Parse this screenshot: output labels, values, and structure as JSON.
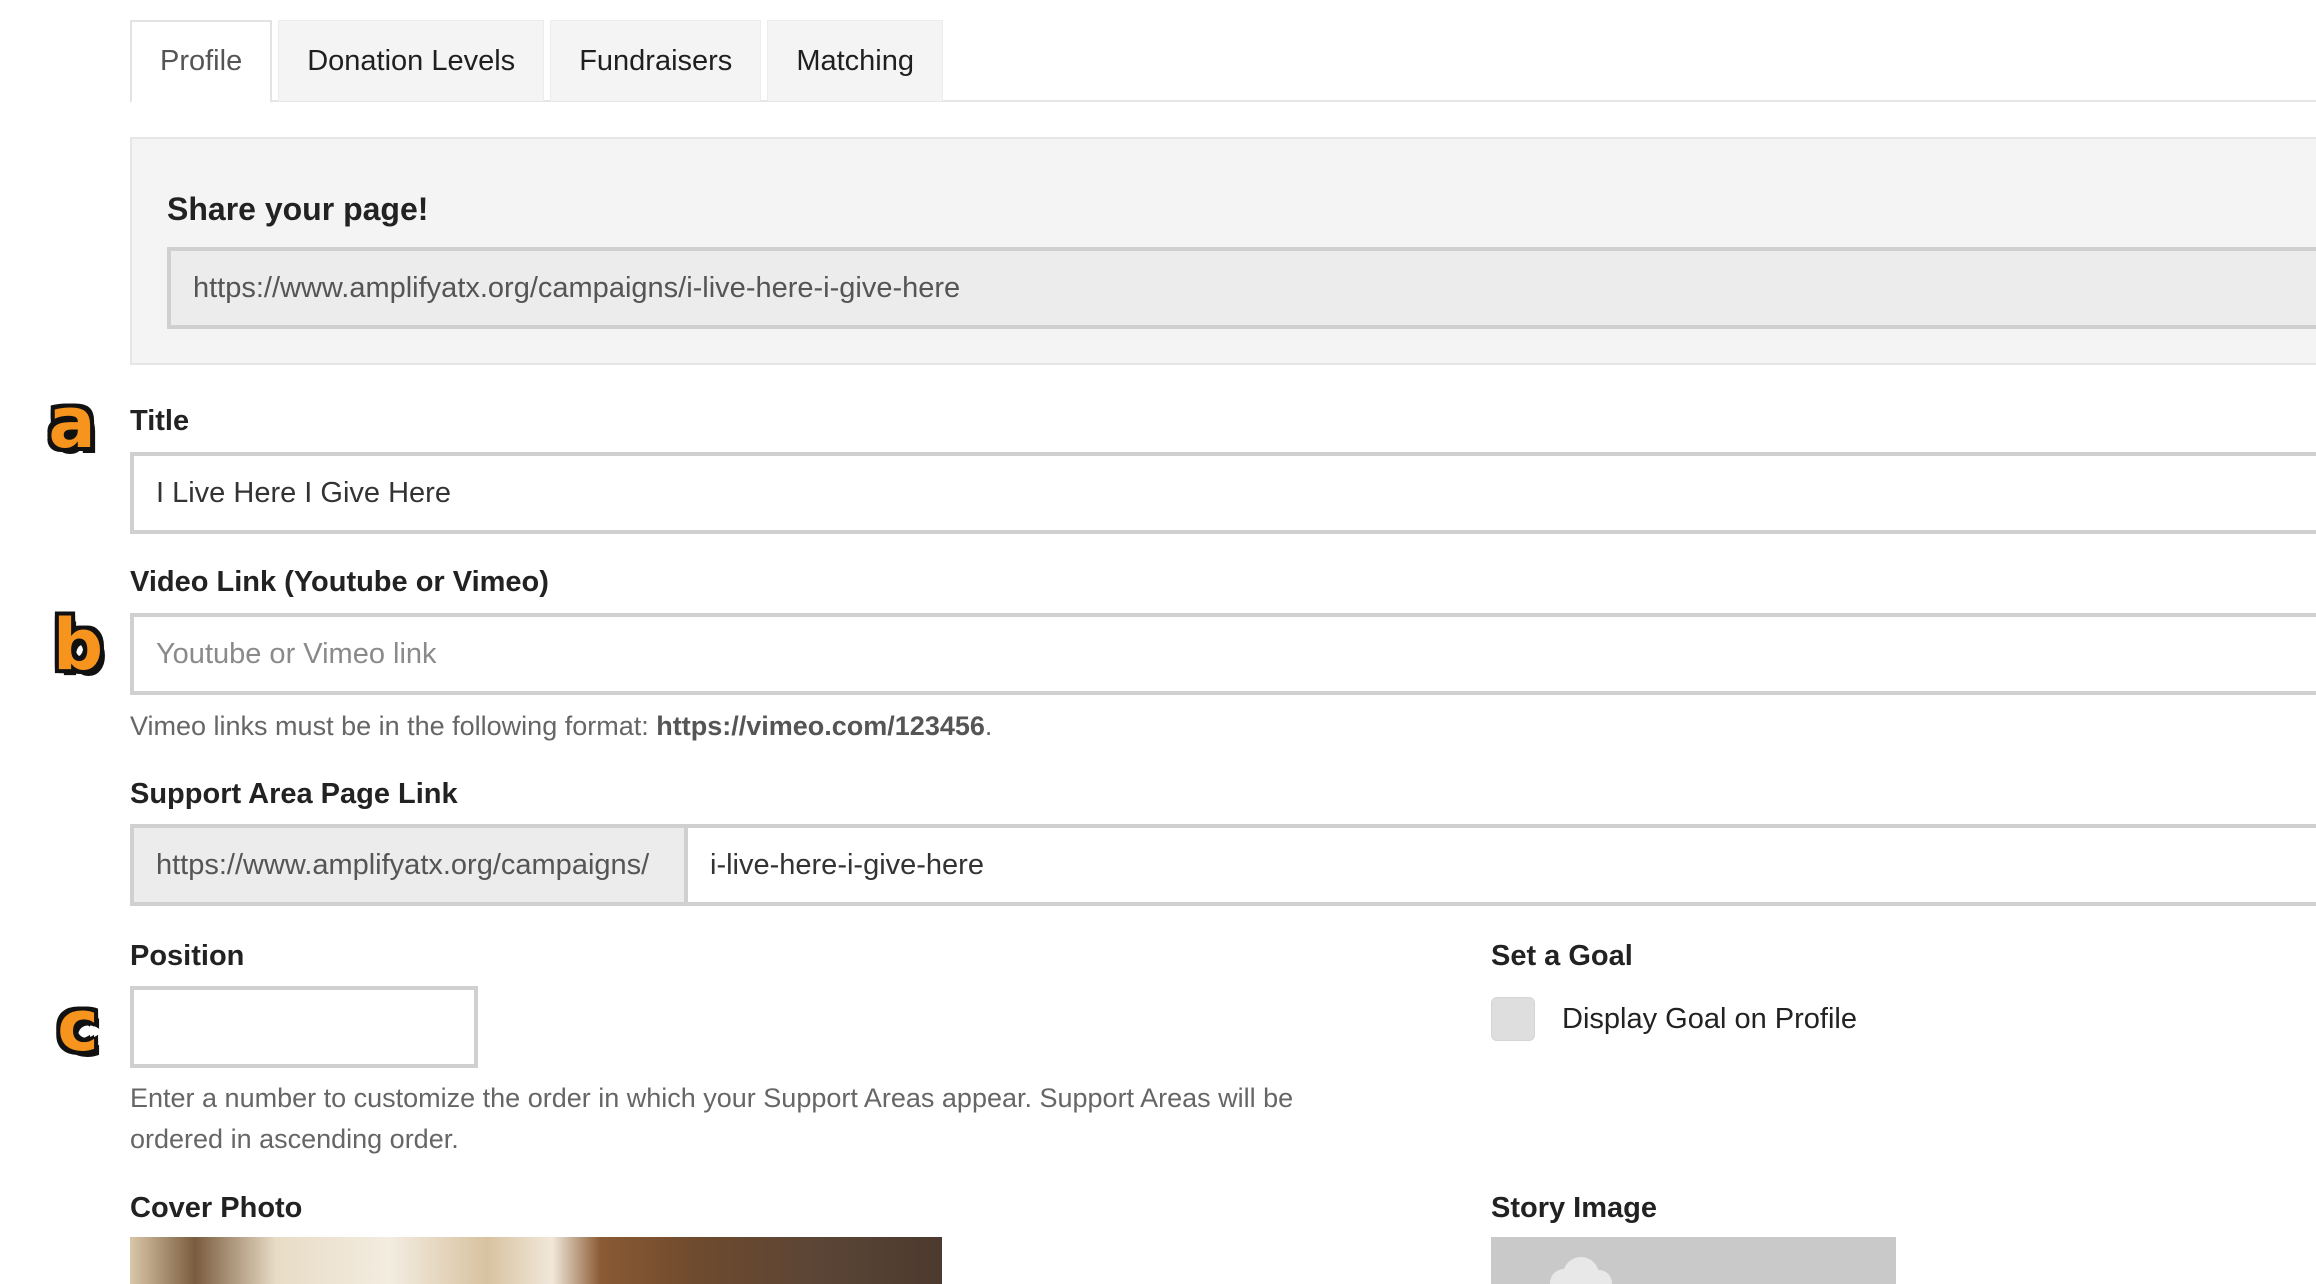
{
  "tabs": [
    {
      "label": "Profile",
      "active": true
    },
    {
      "label": "Donation Levels",
      "active": false
    },
    {
      "label": "Fundraisers",
      "active": false
    },
    {
      "label": "Matching",
      "active": false
    }
  ],
  "share": {
    "heading": "Share your page!",
    "url": "https://www.amplifyatx.org/campaigns/i-live-here-i-give-here"
  },
  "title_field": {
    "label": "Title",
    "value": "I Live Here I Give Here"
  },
  "video_field": {
    "label": "Video Link (Youtube or Vimeo)",
    "placeholder": "Youtube or Vimeo link",
    "help_prefix": "Vimeo links must be in the following format: ",
    "help_example": "https://vimeo.com/123456",
    "help_suffix": "."
  },
  "support_link": {
    "label": "Support Area Page Link",
    "prefix": "https://www.amplifyatx.org/campaigns/",
    "slug": "i-live-here-i-give-here"
  },
  "position_field": {
    "label": "Position",
    "value": "",
    "help": "Enter a number to customize the order in which your Support Areas appear. Support Areas will be ordered in ascending order."
  },
  "goal": {
    "label": "Set a Goal",
    "checkbox_label": "Display Goal on Profile",
    "checked": false
  },
  "cover_photo": {
    "label": "Cover Photo"
  },
  "story_image": {
    "label": "Story Image"
  },
  "markers": [
    "a",
    "b",
    "c"
  ],
  "colors": {
    "marker": "#f7941d",
    "panel_bg": "#f4f4f4",
    "border": "#d0d0d0"
  }
}
